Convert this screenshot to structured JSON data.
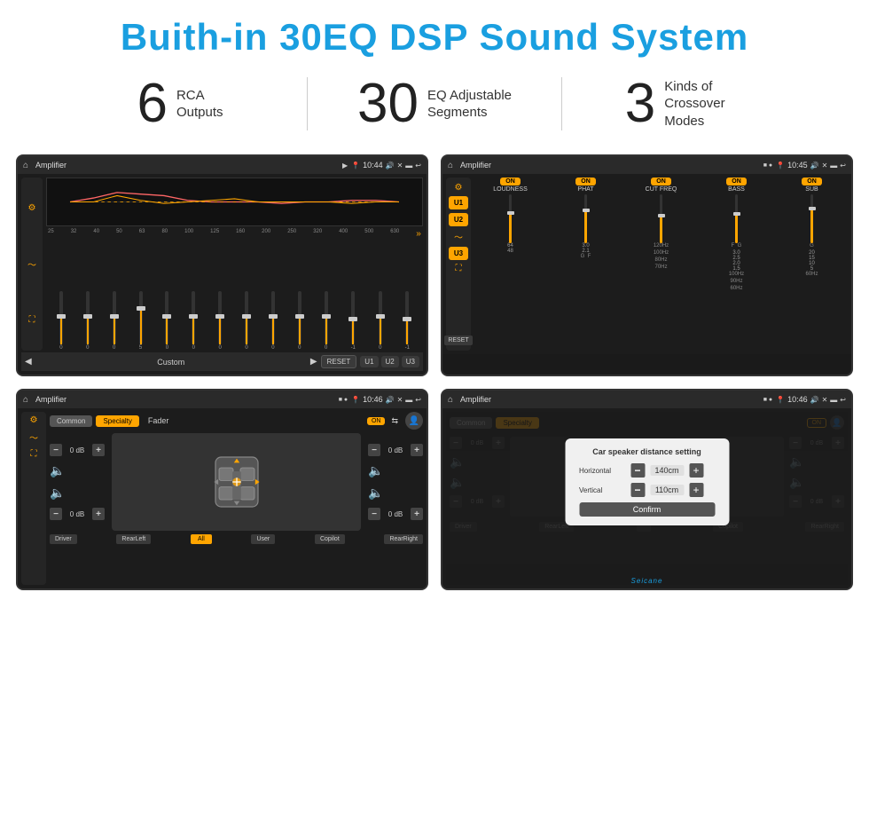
{
  "page": {
    "title": "Buith-in 30EQ DSP Sound System",
    "stats": [
      {
        "number": "6",
        "label": "RCA\nOutputs"
      },
      {
        "number": "30",
        "label": "EQ Adjustable\nSegments"
      },
      {
        "number": "3",
        "label": "Kinds of\nCrossover Modes"
      }
    ]
  },
  "screens": {
    "top_left": {
      "title": "Amplifier",
      "time": "10:44",
      "mode": "Custom",
      "freq_labels": [
        "25",
        "32",
        "40",
        "50",
        "63",
        "80",
        "100",
        "125",
        "160",
        "200",
        "250",
        "320",
        "400",
        "500",
        "630"
      ],
      "values": [
        "0",
        "0",
        "0",
        "5",
        "0",
        "0",
        "0",
        "0",
        "0",
        "0",
        "0",
        "-1",
        "0",
        "-1"
      ],
      "buttons": [
        "RESET",
        "U1",
        "U2",
        "U3"
      ]
    },
    "top_right": {
      "title": "Amplifier",
      "time": "10:45",
      "u_buttons": [
        "U1",
        "U2",
        "U3"
      ],
      "controls": [
        "LOUDNESS",
        "PHAT",
        "CUT FREQ",
        "BASS",
        "SUB"
      ],
      "on_labels": [
        "ON",
        "ON",
        "ON",
        "ON",
        "ON"
      ],
      "reset_label": "RESET"
    },
    "bottom_left": {
      "title": "Amplifier",
      "time": "10:46",
      "tabs": [
        "Common",
        "Specialty"
      ],
      "active_tab": "Specialty",
      "fader_label": "Fader",
      "on_label": "ON",
      "positions": {
        "driver": "Driver",
        "rear_left": "RearLeft",
        "all": "All",
        "user": "User",
        "copilot": "Copilot",
        "rear_right": "RearRight"
      },
      "volumes": [
        "0 dB",
        "0 dB",
        "0 dB",
        "0 dB"
      ]
    },
    "bottom_right": {
      "title": "Amplifier",
      "time": "10:46",
      "tabs": [
        "Common",
        "Specialty"
      ],
      "on_label": "ON",
      "dialog": {
        "title": "Car speaker distance setting",
        "horizontal_label": "Horizontal",
        "horizontal_value": "140cm",
        "vertical_label": "Vertical",
        "vertical_value": "110cm",
        "confirm_label": "Confirm"
      },
      "positions": {
        "driver": "Driver",
        "rear_left": "RearLeft",
        "copilot": "Copilot",
        "rear_right": "RearRight"
      },
      "watermark": "Seicane"
    }
  }
}
